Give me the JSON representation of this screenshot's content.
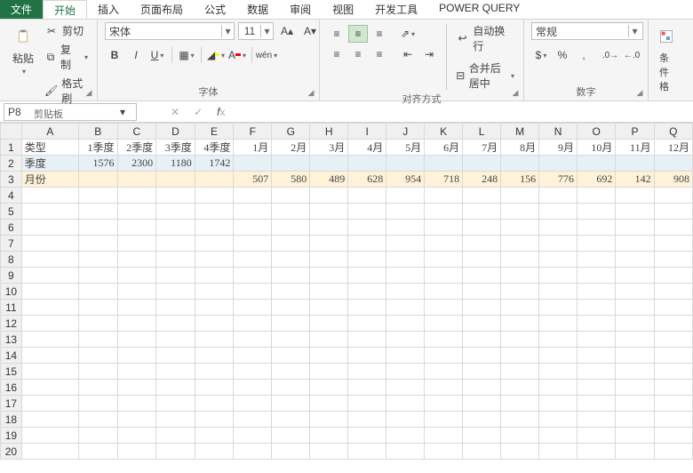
{
  "tabs": {
    "file": "文件",
    "home": "开始",
    "insert": "插入",
    "layout": "页面布局",
    "formulas": "公式",
    "data": "数据",
    "review": "审阅",
    "view": "视图",
    "dev": "开发工具",
    "pq": "POWER QUERY"
  },
  "ribbon": {
    "clipboard": {
      "label": "剪贴板",
      "paste": "粘贴",
      "cut": "剪切",
      "copy": "复制",
      "painter": "格式刷"
    },
    "font": {
      "label": "字体",
      "name": "宋体",
      "size": "11"
    },
    "align": {
      "label": "对齐方式",
      "wrap": "自动换行",
      "merge": "合并后居中"
    },
    "number": {
      "label": "数字",
      "format": "常规"
    },
    "cond": {
      "label": "条件格"
    }
  },
  "namebox": "P8",
  "chart_data": {
    "type": "table",
    "columns": [
      "类型",
      "1季度",
      "2季度",
      "3季度",
      "4季度",
      "1月",
      "2月",
      "3月",
      "4月",
      "5月",
      "6月",
      "7月",
      "8月",
      "9月",
      "10月",
      "11月",
      "12月"
    ],
    "rows": [
      {
        "label": "季度",
        "values": [
          1576,
          2300,
          1180,
          1742,
          null,
          null,
          null,
          null,
          null,
          null,
          null,
          null,
          null,
          null,
          null,
          null
        ]
      },
      {
        "label": "月份",
        "values": [
          null,
          null,
          null,
          null,
          507,
          580,
          489,
          628,
          954,
          718,
          248,
          156,
          776,
          692,
          142,
          908
        ]
      }
    ]
  },
  "colhdrs": [
    "A",
    "B",
    "C",
    "D",
    "E",
    "F",
    "G",
    "H",
    "I",
    "J",
    "K",
    "L",
    "M",
    "N",
    "O",
    "P",
    "Q"
  ],
  "rowcount": 20
}
